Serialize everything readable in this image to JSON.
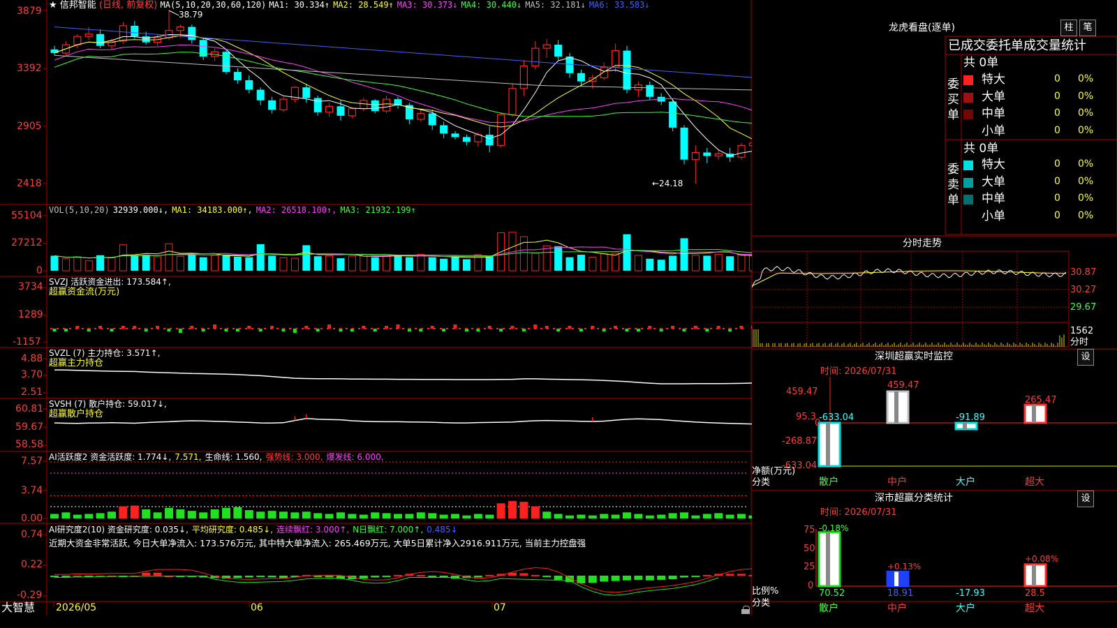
{
  "main": {
    "star": "★",
    "title": "信邦智能",
    "period": "(日线, 前复权)",
    "ma_prefix": "MA(5,10,20,30,60,120)",
    "ma": [
      {
        "label": "MA1: 30.334↑",
        "color": "#ffffff"
      },
      {
        "label": "MA2: 28.549↑",
        "color": "#ffff3c"
      },
      {
        "label": "MA3: 30.373↓",
        "color": "#ff40ff"
      },
      {
        "label": "MA4: 30.440↓",
        "color": "#40ff40"
      },
      {
        "label": "MA5: 32.181↓",
        "color": "#c0c0c0"
      },
      {
        "label": "MA6: 33.583↓",
        "color": "#4060ff"
      }
    ],
    "y_ticks": [
      "3879",
      "3392",
      "2905",
      "2418"
    ],
    "high_label": "38.79",
    "low_label": "←24.18"
  },
  "volume": {
    "header": [
      {
        "text": "VOL(5,10,20)",
        "color": "#c0c0c0"
      },
      {
        "text": "32939.000↓,",
        "color": "#ffffff"
      },
      {
        "text": "MA1: 34183.000↑,",
        "color": "#ffff3c"
      },
      {
        "text": "MA2: 26518.100↑,",
        "color": "#ff40ff"
      },
      {
        "text": "MA3: 21932.199↑",
        "color": "#40ff40"
      }
    ],
    "y_ticks": [
      "55104",
      "27212",
      "0"
    ]
  },
  "svzj": {
    "header": "SVZJ  活跃资金进出: 173.584↑,",
    "subtitle": "超赢资金流(万元)",
    "y_ticks": [
      "3734",
      "1289",
      "-1157"
    ]
  },
  "svzl": {
    "header": "SVZL (7) 主力持仓: 3.571↑,",
    "subtitle": "超赢主力持仓",
    "y_ticks": [
      "4.88",
      "3.70",
      "2.51"
    ]
  },
  "svsh": {
    "header": "SVSH (7) 散户持仓: 59.017↓,",
    "subtitle": "超赢散户持仓",
    "y_ticks": [
      "60.81",
      "59.67",
      "58.58"
    ]
  },
  "ai2": {
    "header": [
      {
        "text": "AI活跃度2 资金活跃度: 1.774↓,",
        "color": "#ffffff"
      },
      {
        "text": "7.571,",
        "color": "#ffff3c"
      },
      {
        "text": "生命线: 1.560,",
        "color": "#ffffff"
      },
      {
        "text": "强势线: 3.000,",
        "color": "#ff3c3c"
      },
      {
        "text": "爆发线: 6.000,",
        "color": "#ff40ff"
      }
    ],
    "y_ticks": [
      "7.57",
      "3.74",
      "0.00"
    ]
  },
  "ai10": {
    "header": [
      {
        "text": "AI研究度2(10) 资金研究度: 0.035↓,",
        "color": "#ffffff"
      },
      {
        "text": "平均研究度: 0.485↓,",
        "color": "#ffff3c"
      },
      {
        "text": "连续飘红: 3.000↑,",
        "color": "#ff40ff"
      },
      {
        "text": "N日飘红: 7.000↑,",
        "color": "#40ff40"
      },
      {
        "text": "0.485↓",
        "color": "#4060ff"
      }
    ],
    "comment": "近期大资金非常活跃, 今日大单净流入: 173.576万元, 其中特大单净流入: 265.469万元, 大单5日累计净入2916.911万元, 当前主力控盘强",
    "y_ticks": [
      "0.74",
      "0.22",
      "-0.29"
    ]
  },
  "bottom": {
    "brand": "大智慧",
    "dates": [
      "2026/05",
      "06",
      "07"
    ]
  },
  "right": {
    "lhb_title": "龙虎看盘(逐单)",
    "btn_bar": "柱",
    "btn_pen": "笔",
    "stats_title": "已成交委托单成交量统计",
    "buy_label": "委买单",
    "sell_label": "委卖单",
    "buy_total": "共 0单",
    "sell_total": "共 0单",
    "buy_rows": [
      {
        "name": "特大",
        "count": "0",
        "pct": "0%",
        "color": "#ff2020"
      },
      {
        "name": "大单",
        "count": "0",
        "pct": "0%",
        "color": "#a01010"
      },
      {
        "name": "中单",
        "count": "0",
        "pct": "0%",
        "color": "#700808"
      },
      {
        "name": "小单",
        "count": "0",
        "pct": "0%",
        "color": ""
      }
    ],
    "sell_rows": [
      {
        "name": "特大",
        "count": "0",
        "pct": "0%",
        "color": "#00e0e0"
      },
      {
        "name": "大单",
        "count": "0",
        "pct": "0%",
        "color": "#00a0a0"
      },
      {
        "name": "中单",
        "count": "0",
        "pct": "0%",
        "color": "#007070"
      },
      {
        "name": "小单",
        "count": "0",
        "pct": "0%",
        "color": ""
      }
    ],
    "fs_title": "分时走势",
    "fs_ticks": [
      "30.87",
      "30.27",
      "29.67"
    ],
    "fs_vol": "1562",
    "fs_vol_label": "分时",
    "sz_title": "深圳超赢实时监控",
    "sz_time": "时间: 2026/07/31",
    "sz_btn": "设",
    "sz_ticks": [
      "459.47",
      "95.3",
      "-268.87",
      "-633.04",
      "0"
    ],
    "sz_axis_label1": "净额(万元)",
    "sz_axis_label2": "分类",
    "sc_title": "深市超赢分类统计",
    "sc_time": "时间: 2026/07/31",
    "sc_btn": "设",
    "sc_ticks": [
      "75",
      "50",
      "25",
      "0"
    ],
    "sc_axis_label1": "比例%",
    "sc_axis_label2": "分类",
    "categories": [
      "散户",
      "中户",
      "大户",
      "超大"
    ]
  },
  "chart_data": [
    {
      "type": "candlestick",
      "title": "信邦智能 (日线, 前复权)",
      "y_ticks": [
        38.79,
        33.92,
        29.05,
        24.18
      ],
      "ylim": [
        24.18,
        38.79
      ],
      "x_tick_labels": [
        "2026/05",
        "06",
        "07"
      ],
      "ohlc": [
        [
          35.5,
          35.8,
          35.0,
          35.2
        ],
        [
          35.2,
          36.2,
          35.0,
          35.9
        ],
        [
          35.9,
          36.8,
          35.6,
          36.6
        ],
        [
          36.6,
          37.4,
          36.3,
          36.8
        ],
        [
          36.8,
          37.2,
          35.6,
          35.8
        ],
        [
          35.8,
          36.4,
          35.5,
          36.2
        ],
        [
          36.2,
          37.8,
          36.0,
          37.5
        ],
        [
          37.5,
          37.9,
          36.4,
          36.6
        ],
        [
          36.6,
          37.0,
          35.9,
          36.1
        ],
        [
          36.1,
          36.8,
          35.8,
          36.5
        ],
        [
          36.5,
          38.79,
          36.3,
          37.1
        ],
        [
          37.1,
          37.6,
          36.5,
          37.4
        ],
        [
          37.4,
          37.6,
          36.0,
          36.3
        ],
        [
          36.3,
          36.5,
          34.6,
          34.9
        ],
        [
          34.9,
          35.6,
          34.5,
          35.3
        ],
        [
          35.3,
          35.5,
          33.4,
          33.6
        ],
        [
          33.6,
          33.9,
          32.6,
          32.9
        ],
        [
          32.9,
          33.3,
          31.8,
          32.1
        ],
        [
          32.1,
          32.3,
          30.8,
          31.2
        ],
        [
          31.2,
          31.5,
          30.1,
          30.4
        ],
        [
          30.4,
          31.5,
          30.2,
          31.3
        ],
        [
          31.3,
          32.4,
          31.0,
          32.3
        ],
        [
          32.3,
          32.6,
          31.0,
          31.4
        ],
        [
          31.4,
          31.6,
          29.9,
          30.2
        ],
        [
          30.2,
          31.0,
          29.8,
          30.7
        ],
        [
          30.7,
          31.2,
          29.5,
          29.9
        ],
        [
          29.9,
          30.6,
          29.7,
          30.5
        ],
        [
          30.5,
          31.4,
          30.3,
          31.2
        ],
        [
          31.2,
          31.3,
          30.1,
          30.3
        ],
        [
          30.3,
          31.6,
          30.1,
          31.3
        ],
        [
          31.3,
          31.5,
          30.5,
          30.8
        ],
        [
          30.8,
          31.0,
          29.2,
          29.6
        ],
        [
          29.6,
          30.4,
          29.4,
          30.1
        ],
        [
          30.1,
          30.4,
          28.7,
          29.1
        ],
        [
          29.1,
          29.4,
          28.0,
          28.4
        ],
        [
          28.4,
          28.6,
          27.9,
          28.1
        ],
        [
          28.1,
          28.3,
          27.4,
          27.7
        ],
        [
          27.7,
          28.5,
          27.3,
          28.3
        ],
        [
          28.3,
          29.0,
          26.8,
          27.4
        ],
        [
          27.4,
          30.2,
          27.2,
          30.0
        ],
        [
          30.0,
          32.6,
          29.8,
          32.2
        ],
        [
          32.2,
          34.6,
          31.6,
          34.1
        ],
        [
          34.1,
          36.2,
          33.8,
          35.6
        ],
        [
          35.6,
          36.4,
          34.8,
          35.9
        ],
        [
          35.9,
          36.3,
          34.6,
          34.9
        ],
        [
          34.9,
          35.2,
          33.1,
          33.5
        ],
        [
          33.5,
          33.8,
          32.4,
          32.8
        ],
        [
          32.8,
          33.4,
          32.2,
          33.1
        ],
        [
          33.1,
          34.4,
          32.9,
          34.0
        ],
        [
          34.0,
          36.0,
          33.6,
          35.4
        ],
        [
          35.4,
          35.8,
          31.8,
          32.1
        ],
        [
          32.1,
          32.8,
          31.5,
          32.5
        ],
        [
          32.5,
          32.8,
          31.2,
          31.5
        ],
        [
          31.5,
          31.8,
          30.8,
          31.1
        ],
        [
          31.1,
          31.3,
          28.6,
          28.9
        ],
        [
          28.9,
          29.1,
          25.8,
          26.2
        ],
        [
          26.2,
          27.4,
          24.18,
          26.8
        ],
        [
          26.8,
          27.2,
          25.9,
          26.5
        ],
        [
          26.5,
          27.0,
          26.2,
          26.7
        ],
        [
          26.7,
          27.2,
          26.0,
          26.4
        ],
        [
          26.4,
          27.6,
          26.2,
          27.4
        ],
        [
          27.4,
          28.2,
          27.0,
          27.6
        ],
        [
          27.6,
          29.0,
          27.3,
          28.6
        ],
        [
          28.6,
          33.8,
          28.4,
          33.6
        ],
        [
          33.6,
          33.8,
          29.8,
          30.1
        ],
        [
          30.1,
          31.4,
          29.8,
          30.7
        ]
      ],
      "ma": {
        "MA1": 30.334,
        "MA2": 28.549,
        "MA3": 30.373,
        "MA4": 30.44,
        "MA5": 32.181,
        "MA6": 33.583
      }
    },
    {
      "type": "bar",
      "title": "VOL(5,10,20)",
      "y_ticks": [
        55104,
        27212,
        0
      ],
      "values": [
        15000,
        12000,
        14000,
        10000,
        15500,
        13000,
        26000,
        15500,
        16000,
        14000,
        27000,
        14500,
        16000,
        13500,
        15500,
        16000,
        14000,
        13500,
        26500,
        15000,
        13000,
        12500,
        25500,
        14500,
        15000,
        12500,
        15000,
        16000,
        13500,
        15000,
        15500,
        13500,
        16500,
        13500,
        12000,
        14000,
        11500,
        16000,
        15000,
        38000,
        38500,
        34000,
        17500,
        25000,
        24500,
        13500,
        16000,
        13500,
        17000,
        17500,
        36500,
        15500,
        12000,
        11000,
        15000,
        32500,
        15500,
        15000,
        16500,
        14500,
        16000,
        15000,
        16500,
        54000,
        52000,
        32939
      ],
      "series": [
        {
          "name": "MA1",
          "last": 34183.0
        },
        {
          "name": "MA2",
          "last": 26518.1
        },
        {
          "name": "MA3",
          "last": 21932.199
        }
      ]
    },
    {
      "type": "bar",
      "title": "SVZJ 活跃资金进出",
      "y_ticks": [
        3734,
        1289,
        -1157
      ],
      "last": 173.584
    },
    {
      "type": "line",
      "title": "SVZL (7) 主力持仓",
      "y_ticks": [
        4.88,
        3.7,
        2.51
      ],
      "last": 3.571
    },
    {
      "type": "line",
      "title": "SVSH (7) 散户持仓",
      "y_ticks": [
        60.81,
        59.67,
        58.58
      ],
      "last": 59.017
    },
    {
      "type": "bar",
      "title": "AI活跃度2",
      "y_ticks": [
        7.57,
        3.74,
        0.0
      ],
      "values_last": {
        "资金活跃度": 1.774,
        "line2": 7.571,
        "生命线": 1.56,
        "强势线": 3.0,
        "爆发线": 6.0
      }
    },
    {
      "type": "bar",
      "title": "AI研究度2(10)",
      "y_ticks": [
        0.74,
        0.22,
        -0.29
      ],
      "values_last": {
        "资金研究度": 0.035,
        "平均研究度": 0.485,
        "连续飘红": 3.0,
        "N日飘红": 7.0
      }
    },
    {
      "type": "bar",
      "title": "深圳超赢实时监控",
      "categories": [
        "散户",
        "中户",
        "大户",
        "超大"
      ],
      "values": [
        -633.04,
        459.47,
        -91.89,
        265.47
      ],
      "ylabel": "净额(万元)",
      "ylim": [
        -633.04,
        459.47
      ]
    },
    {
      "type": "bar",
      "title": "深市超赢分类统计",
      "categories": [
        "散户",
        "中户",
        "大户",
        "超大"
      ],
      "values": [
        70.52,
        18.91,
        -17.93,
        28.5
      ],
      "changes": [
        "-0.18%",
        "+0.13%",
        "",
        "+0.08%"
      ],
      "ylabel": "比例%",
      "ylim": [
        0,
        75
      ]
    }
  ]
}
